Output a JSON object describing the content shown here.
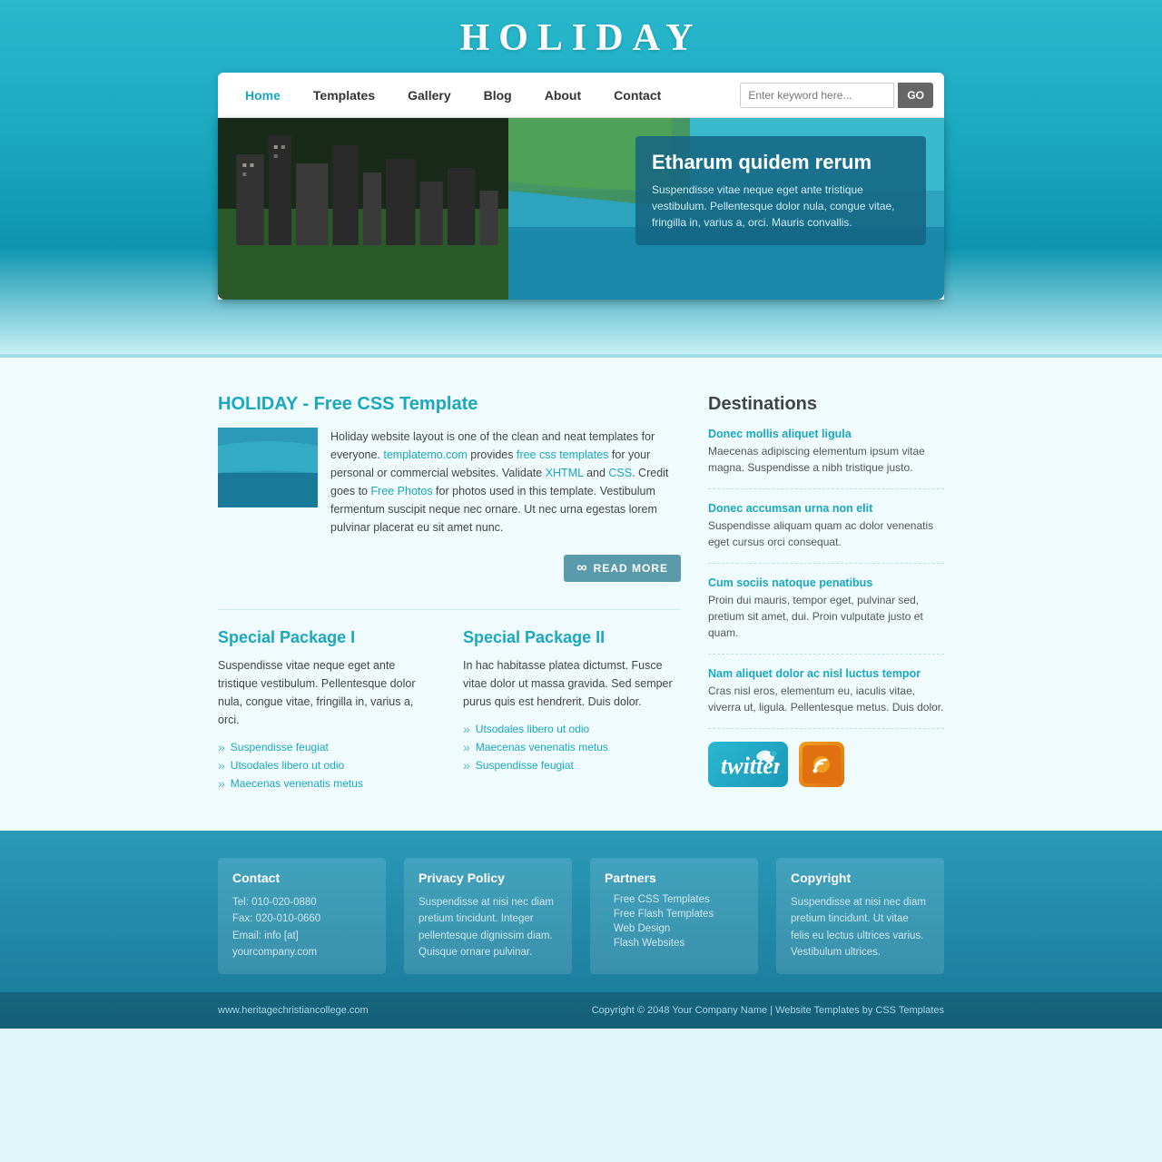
{
  "site": {
    "title": "HOLIDAY"
  },
  "nav": {
    "items": [
      {
        "label": "Home",
        "active": true
      },
      {
        "label": "Templates",
        "active": false
      },
      {
        "label": "Gallery",
        "active": false
      },
      {
        "label": "Blog",
        "active": false
      },
      {
        "label": "About",
        "active": false
      },
      {
        "label": "Contact",
        "active": false
      }
    ],
    "search_placeholder": "Enter keyword here...",
    "search_button": "GO"
  },
  "hero": {
    "heading": "Etharum quidem rerum",
    "text": "Suspendisse vitae neque eget ante tristique vestibulum. Pellentesque dolor nula, congue vitae, fringilla in, varius a, orci. Mauris convallis."
  },
  "about": {
    "section_title": "HOLIDAY - Free CSS Template",
    "text1": "Holiday website layout is one of the clean and neat templates for everyone.",
    "link1": "templatemo.com",
    "text2": " provides ",
    "link2": "free css templates",
    "text3": " for your personal or commercial websites. Validate ",
    "link3": "XHTML",
    "text4": " and ",
    "link4": "CSS",
    "text5": ". Credit goes to ",
    "link5": "Free Photos",
    "text6": " for photos used in this template. Vestibulum fermentum suscipit neque nec ornare. Ut nec urna egestas lorem pulvinar placerat eu sit amet nunc.",
    "read_more": "READ MORE"
  },
  "packages": [
    {
      "title": "Special Package I",
      "text": "Suspendisse vitae neque eget ante tristique vestibulum. Pellentesque dolor nula, congue vitae, fringilla in, varius a, orci.",
      "items": [
        "Suspendisse feugiat",
        "Utsodales libero ut odio",
        "Maecenas venenatis metus"
      ]
    },
    {
      "title": "Special Package II",
      "text": "In hac habitasse platea dictumst. Fusce vitae dolor ut massa gravida. Sed semper purus quis est hendrerit. Duis dolor.",
      "items": [
        "Utsodales libero ut odio",
        "Maecenas venenatis metus",
        "Suspendisse feugiat"
      ]
    }
  ],
  "destinations": {
    "title": "Destinations",
    "items": [
      {
        "link": "Donec mollis aliquet ligula",
        "desc": "Maecenas adipiscing elementum ipsum vitae magna. Suspendisse a nibh tristique justo."
      },
      {
        "link": "Donec accumsan urna non elit",
        "desc": "Suspendisse aliquam quam ac dolor venenatis eget cursus orci consequat."
      },
      {
        "link": "Cum sociis natoque penatibus",
        "desc": "Proin dui mauris, tempor eget, pulvinar sed, pretium sit amet, dui. Proin vulputate justo et quam."
      },
      {
        "link": "Nam aliquet dolor ac nisl luctus tempor",
        "desc": "Cras nisl eros, elementum eu, iaculis vitae, viverra ut, ligula. Pellentesque metus. Duis dolor."
      }
    ]
  },
  "footer": {
    "columns": [
      {
        "title": "Contact",
        "lines": [
          "Tel: 010-020-0880",
          "Fax: 020-010-0660",
          "Email: info [at] yourcompany.com"
        ]
      },
      {
        "title": "Privacy Policy",
        "text": "Suspendisse at nisi nec diam pretium tincidunt. Integer pellentesque dignissim diam. Quisque ornare pulvinar."
      },
      {
        "title": "Partners",
        "links": [
          "Free CSS Templates",
          "Free Flash Templates",
          "Web Design",
          "Flash Websites"
        ]
      },
      {
        "title": "Copyright",
        "text": "Suspendisse at nisi nec diam pretium tincidunt. Ut vitae felis eu lectus ultrices varius. Vestibulum ultrices."
      }
    ],
    "bottom": {
      "domain": "www.heritagechristiancollege.com",
      "copyright": "Copyright © 2048",
      "company_link": "Your Company Name",
      "sep1": " | ",
      "templates_link": "Website Templates",
      "by": " by ",
      "css_link": "CSS Templates"
    }
  }
}
